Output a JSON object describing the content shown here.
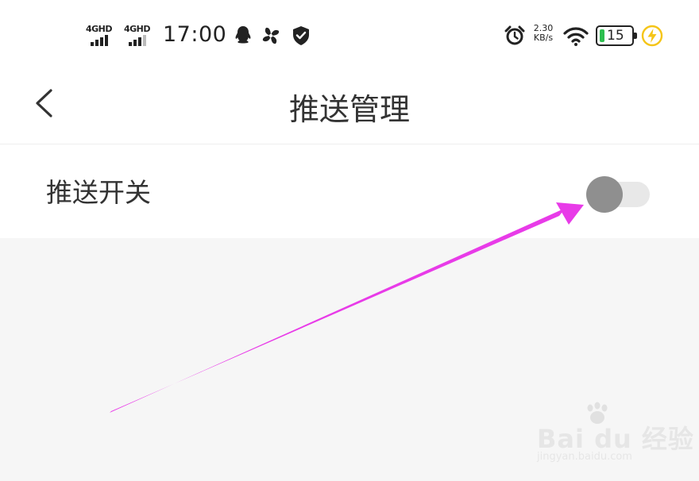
{
  "status_bar": {
    "signal_1": {
      "label": "4GHD"
    },
    "signal_2": {
      "label": "4GHD"
    },
    "time": "17:00",
    "icons": [
      "qq-icon",
      "pinwheel-icon",
      "shield-icon",
      "alarm-icon",
      "wifi-icon",
      "charging-icon"
    ],
    "network_speed": {
      "value": "2.30",
      "unit": "KB/s"
    },
    "battery": {
      "level": "15",
      "fill_color": "#2dbe4f"
    },
    "charging_color": "#f5c518"
  },
  "nav": {
    "title": "推送管理",
    "back_icon": "chevron-left-icon"
  },
  "settings": {
    "push_switch": {
      "label": "推送开关",
      "enabled": false
    }
  },
  "annotation": {
    "arrow_color": "#e83be8"
  },
  "watermark": {
    "brand": "Bai du 经验",
    "url": "jingyan.baidu.com"
  }
}
